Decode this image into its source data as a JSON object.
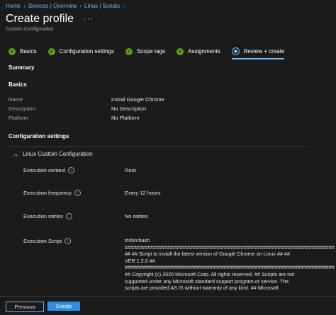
{
  "breadcrumb": [
    "Home",
    "Devices | Overview",
    "Linux | Scripts"
  ],
  "header": {
    "title": "Create profile",
    "more_label": "···",
    "subtitle": "Custom Configuration"
  },
  "steps": [
    {
      "label": "Basics",
      "state": "complete"
    },
    {
      "label": "Configuration settings",
      "state": "complete"
    },
    {
      "label": "Scope tags",
      "state": "complete"
    },
    {
      "label": "Assignments",
      "state": "complete"
    },
    {
      "label": "Review + create",
      "state": "active"
    }
  ],
  "summary": {
    "heading": "Summary"
  },
  "basics": {
    "heading": "Basics",
    "fields": [
      {
        "key": "Name",
        "value": "Install Google Chrome"
      },
      {
        "key": "Description",
        "value": "No Description"
      },
      {
        "key": "Platform",
        "value": "No Platform"
      }
    ]
  },
  "config": {
    "heading": "Configuration settings",
    "group_label": "Linux Custom Configuration",
    "rows": [
      {
        "key": "Execution context",
        "value": "Root"
      },
      {
        "key": "Execution frequency",
        "value": "Every 12 hours"
      },
      {
        "key": "Execution retries",
        "value": "No retries"
      },
      {
        "key": "Execution Script",
        "value": ""
      }
    ],
    "script_lines": [
      "#!/bin/bash",
      "##############################################################################################",
      "## ## Script to install the latest version of Google Chrome on Linux ## ##",
      "VER 1.2.0 ##",
      "##############################################################################################",
      "## Copyright (c) 2020 Microsoft Corp. All rights reserved. ## Scripts are not",
      "supported under any Microsoft standard support program or service. The",
      "scripts are provided AS IS without warranty of any kind. ## Microsoft"
    ]
  },
  "footer": {
    "previous_label": "Previous",
    "create_label": "Create"
  },
  "colors": {
    "accent": "#6cb8f6",
    "success": "#57a300",
    "primary_button": "#2f8fe8",
    "background": "#1b1b1b"
  }
}
